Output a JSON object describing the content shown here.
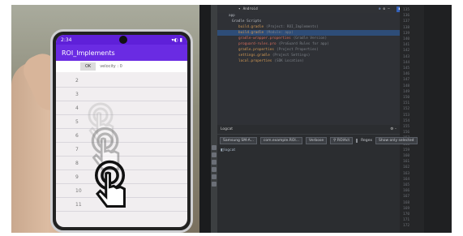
{
  "phone": {
    "status_time": "2:34",
    "app_title": "ROI_Implements",
    "ok_label": "OK",
    "velocity_text": "velocity : 0",
    "row_numbers": [
      "2",
      "3",
      "4",
      "5",
      "6",
      "7",
      "8",
      "9",
      "10",
      "11"
    ]
  },
  "ide": {
    "project_dropdown": "Android",
    "run_badge": "■■■■■■■■■",
    "tree": [
      {
        "text": "app",
        "class": ""
      },
      {
        "text": "Gradle Scripts",
        "class": ""
      },
      {
        "text": "build.gradle",
        "hint": "(Project: ROI_Implements)",
        "class": "orange"
      },
      {
        "text": "build.gradle",
        "hint": "(Module: app)",
        "class": "orange sel"
      },
      {
        "text": "gradle-wrapper.properties",
        "hint": "(Gradle Version)",
        "class": "red"
      },
      {
        "text": "proguard-rules.pro",
        "hint": "(ProGuard Rules for app)",
        "class": "red"
      },
      {
        "text": "gradle.properties",
        "hint": "(Project Properties)",
        "class": "orange"
      },
      {
        "text": "settings.gradle",
        "hint": "(Project Settings)",
        "class": "orange"
      },
      {
        "text": "local.properties",
        "hint": "(SDK Location)",
        "class": "orange"
      }
    ],
    "logcat_title": "Logcat",
    "device_dropdown": "Samsung SM-A...",
    "package_dropdown": "com.example.ROI...",
    "level_dropdown": "Verbose",
    "search_value": "ROIAct",
    "regex_label": "Regex",
    "filter_dropdown": "Show only selected",
    "logcat_tab": "logcat",
    "gutter_numbers": [
      "135",
      "136",
      "137",
      "138",
      "139",
      "140",
      "141",
      "142",
      "143",
      "144",
      "145",
      "146",
      "147",
      "148",
      "149",
      "150",
      "151",
      "152",
      "153",
      "154",
      "155",
      "156",
      "157",
      "158",
      "159",
      "160",
      "161",
      "162",
      "163",
      "164",
      "165",
      "166",
      "167",
      "168",
      "169",
      "170",
      "171",
      "172"
    ]
  }
}
